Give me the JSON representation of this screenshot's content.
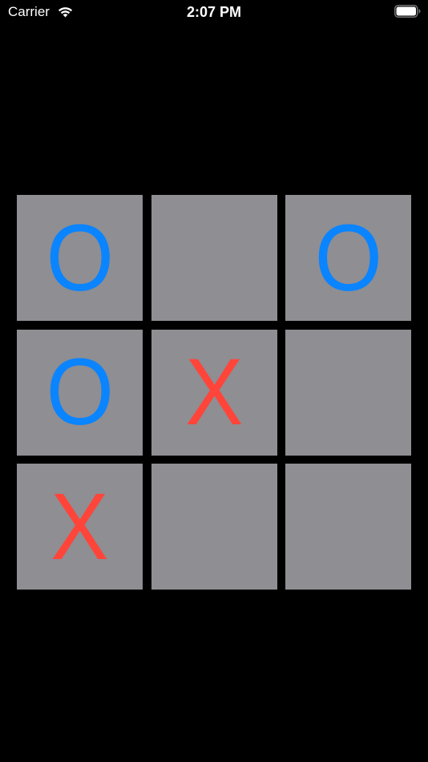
{
  "status_bar": {
    "carrier": "Carrier",
    "time": "2:07 PM",
    "wifi_icon": "wifi-icon",
    "battery_icon": "battery-icon",
    "battery_level": 1.0
  },
  "colors": {
    "background": "#000000",
    "cell": "#8e8e93",
    "o_mark": "#0a84ff",
    "x_mark": "#ff453a"
  },
  "board": {
    "cells": [
      {
        "mark": "O",
        "color": "#0a84ff"
      },
      {
        "mark": "",
        "color": ""
      },
      {
        "mark": "O",
        "color": "#0a84ff"
      },
      {
        "mark": "O",
        "color": "#0a84ff"
      },
      {
        "mark": "X",
        "color": "#ff453a"
      },
      {
        "mark": "",
        "color": ""
      },
      {
        "mark": "X",
        "color": "#ff453a"
      },
      {
        "mark": "",
        "color": ""
      },
      {
        "mark": "",
        "color": ""
      }
    ]
  }
}
